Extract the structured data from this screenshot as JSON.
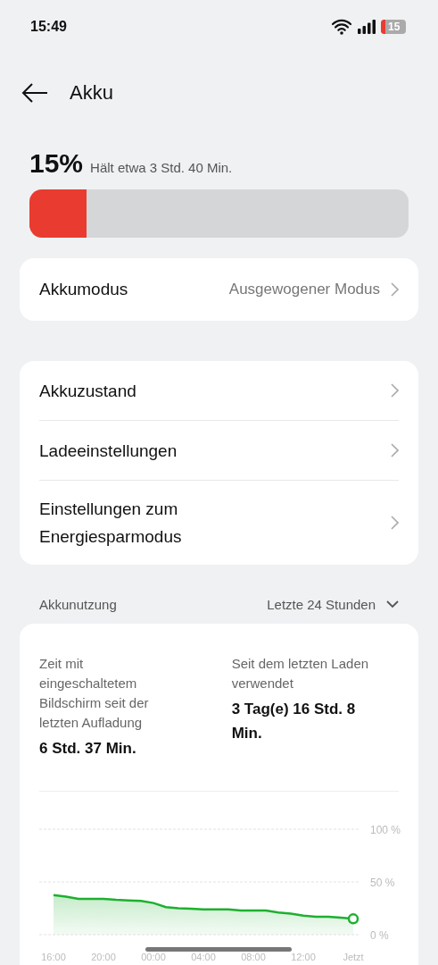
{
  "status_bar": {
    "time": "15:49",
    "battery": "15"
  },
  "header": {
    "title": "Akku"
  },
  "battery": {
    "percent": "15%",
    "estimate": "Hält etwa 3 Std. 40 Min.",
    "level": 0.15
  },
  "mode": {
    "label": "Akkumodus",
    "value": "Ausgewogener Modus"
  },
  "settings": [
    {
      "label": "Akkuzustand"
    },
    {
      "label": "Ladeeinstellungen"
    },
    {
      "label": "Einstellungen zum Energiesparmodus"
    }
  ],
  "usage": {
    "title": "Akkunutzung",
    "period": "Letzte 24 Stunden",
    "stats": [
      {
        "label": "Zeit mit eingeschaltetem Bildschirm seit der letzten Aufladung",
        "value": "6 Std. 37 Min."
      },
      {
        "label": "Seit dem letzten Laden verwendet",
        "value": "3 Tag(e) 16 Std. 8 Min."
      }
    ],
    "chart_data": {
      "type": "area",
      "categories": [
        "16:00",
        null,
        null,
        null,
        "20:00",
        null,
        null,
        null,
        "00:00",
        null,
        null,
        null,
        "04:00",
        null,
        null,
        null,
        "08:00",
        null,
        null,
        null,
        "12:00",
        null,
        null,
        null,
        "Jetzt"
      ],
      "series": [
        {
          "color": "#1db02f",
          "values": [
            37.5,
            36,
            34,
            34,
            34,
            33,
            32.5,
            32,
            30,
            26,
            25,
            24.5,
            24,
            24,
            24,
            23,
            23,
            23,
            21,
            20,
            18,
            17,
            17,
            16,
            15
          ]
        }
      ],
      "ylim": [
        0,
        100
      ],
      "yticks": [
        {
          "value": 100,
          "label": "100 %"
        },
        {
          "value": 50,
          "label": "50 %"
        },
        {
          "value": 0,
          "label": "0 %"
        }
      ]
    }
  }
}
